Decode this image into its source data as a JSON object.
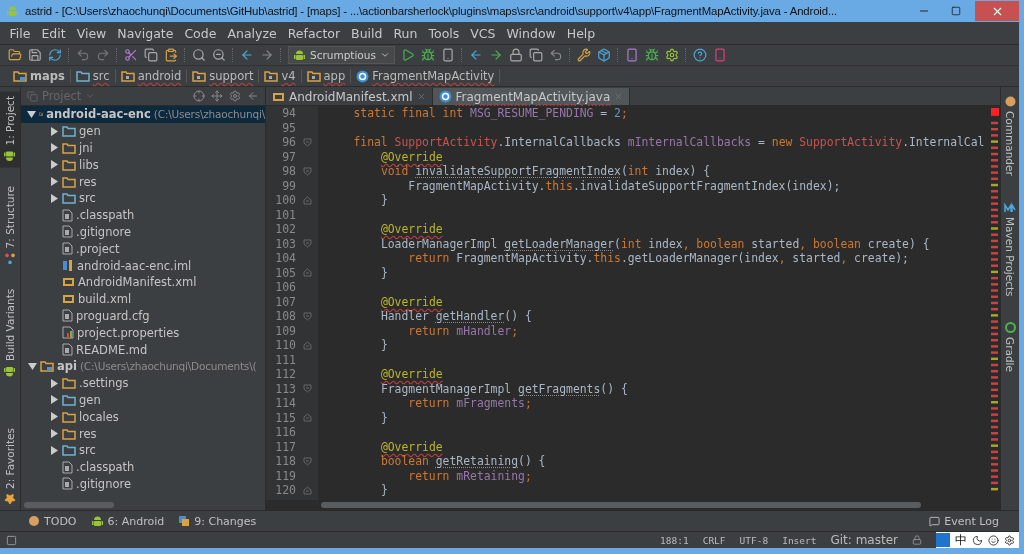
{
  "window": {
    "title": "astrid - [C:\\Users\\zhaochunqi\\Documents\\GitHub\\astrid] - [maps] - ...\\actionbarsherlock\\plugins\\maps\\src\\android\\support\\v4\\app\\FragmentMapActivity.java - Android..."
  },
  "menu": [
    "File",
    "Edit",
    "View",
    "Navigate",
    "Code",
    "Analyze",
    "Refactor",
    "Build",
    "Run",
    "Tools",
    "VCS",
    "Window",
    "Help"
  ],
  "toolbar": {
    "run_config": "Scrumptious"
  },
  "breadcrumbs": [
    {
      "label": "maps",
      "kind": "module"
    },
    {
      "label": "src",
      "kind": "folder"
    },
    {
      "label": "android",
      "kind": "package"
    },
    {
      "label": "support",
      "kind": "package"
    },
    {
      "label": "v4",
      "kind": "package"
    },
    {
      "label": "app",
      "kind": "package"
    },
    {
      "label": "FragmentMapActivity",
      "kind": "class"
    }
  ],
  "left_tool_tabs": [
    {
      "label": "1: Project",
      "kind": "android",
      "selected": true
    },
    {
      "label": "7: Structure",
      "kind": "structure",
      "selected": false
    },
    {
      "label": "Build Variants",
      "kind": "android",
      "selected": false
    },
    {
      "label": "2: Favorites",
      "kind": "star",
      "selected": false
    }
  ],
  "project_panel": {
    "view": "Project",
    "tree": [
      {
        "name": "android-aac-enc",
        "path": "(C:\\Users\\zhaochunqi\\",
        "kind": "module",
        "expanded": true,
        "selected": true,
        "children": [
          {
            "name": "gen",
            "kind": "source-folder",
            "expanded": false,
            "selected": false
          },
          {
            "name": "jni",
            "kind": "folder",
            "expanded": false,
            "selected": false
          },
          {
            "name": "libs",
            "kind": "folder",
            "expanded": false,
            "selected": false
          },
          {
            "name": "res",
            "kind": "folder",
            "expanded": false,
            "selected": false
          },
          {
            "name": "src",
            "kind": "source-folder",
            "expanded": false,
            "selected": false
          },
          {
            "name": ".classpath",
            "kind": "file",
            "selected": false
          },
          {
            "name": ".gitignore",
            "kind": "file",
            "selected": false
          },
          {
            "name": ".project",
            "kind": "file",
            "selected": false
          },
          {
            "name": "android-aac-enc.iml",
            "kind": "iml",
            "selected": false
          },
          {
            "name": "AndroidManifest.xml",
            "kind": "xml",
            "selected": false
          },
          {
            "name": "build.xml",
            "kind": "xml",
            "selected": false
          },
          {
            "name": "proguard.cfg",
            "kind": "file",
            "selected": false
          },
          {
            "name": "project.properties",
            "kind": "properties",
            "selected": false
          },
          {
            "name": "README.md",
            "kind": "file",
            "selected": false
          }
        ]
      },
      {
        "name": "api",
        "path": "(C:\\Users\\zhaochunqi\\Documents\\(",
        "kind": "module",
        "expanded": true,
        "selected": false,
        "children": [
          {
            "name": ".settings",
            "kind": "folder",
            "expanded": false,
            "selected": false
          },
          {
            "name": "gen",
            "kind": "source-folder",
            "expanded": false,
            "selected": false
          },
          {
            "name": "locales",
            "kind": "folder",
            "expanded": false,
            "selected": false
          },
          {
            "name": "res",
            "kind": "folder",
            "expanded": false,
            "selected": false
          },
          {
            "name": "src",
            "kind": "source-folder",
            "expanded": false,
            "selected": false
          },
          {
            "name": ".classpath",
            "kind": "file",
            "selected": false
          },
          {
            "name": ".gitignore",
            "kind": "file",
            "selected": false
          }
        ]
      }
    ]
  },
  "editor_tabs": [
    {
      "label": "AndroidManifest.xml",
      "kind": "xml",
      "selected": false
    },
    {
      "label": "FragmentMapActivity.java",
      "kind": "class",
      "selected": true
    }
  ],
  "code_lines": [
    {
      "number": "94",
      "kind": "plain",
      "tokens": [
        {
          "text": "    static final int ",
          "kind": "keyword"
        },
        {
          "text": "MSG_RESUME_PENDING",
          "kind": "field"
        },
        {
          "text": " = ",
          "kind": "plain"
        },
        {
          "text": "2",
          "kind": "number"
        },
        {
          "text": ";",
          "kind": "keyword"
        }
      ]
    },
    {
      "number": "95",
      "kind": "plain"
    },
    {
      "number": "96",
      "kind": "start",
      "tokens": [
        {
          "text": "    final ",
          "kind": "keyword"
        },
        {
          "text": "SupportActivity",
          "kind": "error"
        },
        {
          "text": ".InternalCallbacks ",
          "kind": "plain"
        },
        {
          "text": "mInternalCallbacks",
          "kind": "field"
        },
        {
          "text": " = ",
          "kind": "plain"
        },
        {
          "text": "new ",
          "kind": "keyword"
        },
        {
          "text": "SupportActivity",
          "kind": "error"
        },
        {
          "text": ".InternalCal",
          "kind": "plain"
        }
      ]
    },
    {
      "number": "97",
      "kind": "plain",
      "tokens": [
        {
          "text": "        @Override",
          "kind": "annotation"
        }
      ]
    },
    {
      "number": "98",
      "kind": "start",
      "tokens": [
        {
          "text": "        void ",
          "kind": "keyword"
        },
        {
          "text": "invalidateSupportFragmentIndex",
          "kind": "unused"
        },
        {
          "text": "(",
          "kind": "plain"
        },
        {
          "text": "int ",
          "kind": "keyword"
        },
        {
          "text": "index) {",
          "kind": "plain"
        }
      ]
    },
    {
      "number": "99",
      "kind": "plain",
      "tokens": [
        {
          "text": "            FragmentMapActivity.",
          "kind": "plain"
        },
        {
          "text": "this",
          "kind": "keyword"
        },
        {
          "text": ".invalidateSupportFragmentIndex(index);",
          "kind": "plain"
        }
      ]
    },
    {
      "number": "100",
      "kind": "end",
      "tokens": [
        {
          "text": "        }",
          "kind": "plain"
        }
      ]
    },
    {
      "number": "101",
      "kind": "plain"
    },
    {
      "number": "102",
      "kind": "plain",
      "tokens": [
        {
          "text": "        @Override",
          "kind": "annotation"
        }
      ]
    },
    {
      "number": "103",
      "kind": "start",
      "tokens": [
        {
          "text": "        LoaderManagerImpl ",
          "kind": "plain"
        },
        {
          "text": "getLoaderManager",
          "kind": "unused"
        },
        {
          "text": "(",
          "kind": "plain"
        },
        {
          "text": "int ",
          "kind": "keyword"
        },
        {
          "text": "index",
          "kind": "plain"
        },
        {
          "text": ", boolean ",
          "kind": "keyword"
        },
        {
          "text": "started",
          "kind": "plain"
        },
        {
          "text": ", boolean ",
          "kind": "keyword"
        },
        {
          "text": "create) {",
          "kind": "plain"
        }
      ]
    },
    {
      "number": "104",
      "kind": "plain",
      "tokens": [
        {
          "text": "            return ",
          "kind": "keyword"
        },
        {
          "text": "FragmentMapActivity.",
          "kind": "plain"
        },
        {
          "text": "this",
          "kind": "keyword"
        },
        {
          "text": ".getLoaderManager(index",
          "kind": "plain"
        },
        {
          "text": ", ",
          "kind": "keyword"
        },
        {
          "text": "started",
          "kind": "plain"
        },
        {
          "text": ", ",
          "kind": "keyword"
        },
        {
          "text": "create);",
          "kind": "plain"
        }
      ]
    },
    {
      "number": "105",
      "kind": "end",
      "tokens": [
        {
          "text": "        }",
          "kind": "plain"
        }
      ]
    },
    {
      "number": "106",
      "kind": "plain"
    },
    {
      "number": "107",
      "kind": "plain",
      "tokens": [
        {
          "text": "        @Override",
          "kind": "annotation"
        }
      ]
    },
    {
      "number": "108",
      "kind": "start",
      "tokens": [
        {
          "text": "        Handler ",
          "kind": "plain"
        },
        {
          "text": "getHandler",
          "kind": "unused"
        },
        {
          "text": "() {",
          "kind": "plain"
        }
      ]
    },
    {
      "number": "109",
      "kind": "plain",
      "tokens": [
        {
          "text": "            return ",
          "kind": "keyword"
        },
        {
          "text": "mHandler",
          "kind": "field"
        },
        {
          "text": ";",
          "kind": "keyword"
        }
      ]
    },
    {
      "number": "110",
      "kind": "end",
      "tokens": [
        {
          "text": "        }",
          "kind": "plain"
        }
      ]
    },
    {
      "number": "111",
      "kind": "plain"
    },
    {
      "number": "112",
      "kind": "plain",
      "tokens": [
        {
          "text": "        @Override",
          "kind": "annotation"
        }
      ]
    },
    {
      "number": "113",
      "kind": "start",
      "tokens": [
        {
          "text": "        FragmentManagerImpl ",
          "kind": "plain"
        },
        {
          "text": "getFragments",
          "kind": "unused"
        },
        {
          "text": "() {",
          "kind": "plain"
        }
      ]
    },
    {
      "number": "114",
      "kind": "plain",
      "tokens": [
        {
          "text": "            return ",
          "kind": "keyword"
        },
        {
          "text": "mFragments",
          "kind": "field"
        },
        {
          "text": ";",
          "kind": "keyword"
        }
      ]
    },
    {
      "number": "115",
      "kind": "end",
      "tokens": [
        {
          "text": "        }",
          "kind": "plain"
        }
      ]
    },
    {
      "number": "116",
      "kind": "plain"
    },
    {
      "number": "117",
      "kind": "plain",
      "tokens": [
        {
          "text": "        @Override",
          "kind": "annotation"
        }
      ]
    },
    {
      "number": "118",
      "kind": "start",
      "tokens": [
        {
          "text": "        boolean ",
          "kind": "keyword"
        },
        {
          "text": "getRetaining",
          "kind": "unused"
        },
        {
          "text": "() {",
          "kind": "plain"
        }
      ]
    },
    {
      "number": "119",
      "kind": "plain",
      "tokens": [
        {
          "text": "            return ",
          "kind": "keyword"
        },
        {
          "text": "mRetaining",
          "kind": "field"
        },
        {
          "text": ";",
          "kind": "keyword"
        }
      ]
    },
    {
      "number": "120",
      "kind": "end",
      "tokens": [
        {
          "text": "        }",
          "kind": "plain"
        }
      ]
    }
  ],
  "right_tool_tabs": [
    {
      "label": "Commander",
      "kind": "commander"
    },
    {
      "label": "Maven Projects",
      "kind": "maven"
    },
    {
      "label": "Gradle",
      "kind": "gradle"
    }
  ],
  "bottom_tool_tabs": [
    {
      "label": "TODO",
      "kind": "todo"
    },
    {
      "label": "6: Android",
      "kind": "android"
    },
    {
      "label": "9: Changes",
      "kind": "changes"
    }
  ],
  "event_log": "Event Log",
  "status_bar": {
    "position": "188:1",
    "line_separator": "CRLF",
    "encoding": "UTF-8",
    "insert_mode": "Insert",
    "vcs_branch": "Git: master"
  },
  "tray": {
    "input_mode": "中"
  }
}
